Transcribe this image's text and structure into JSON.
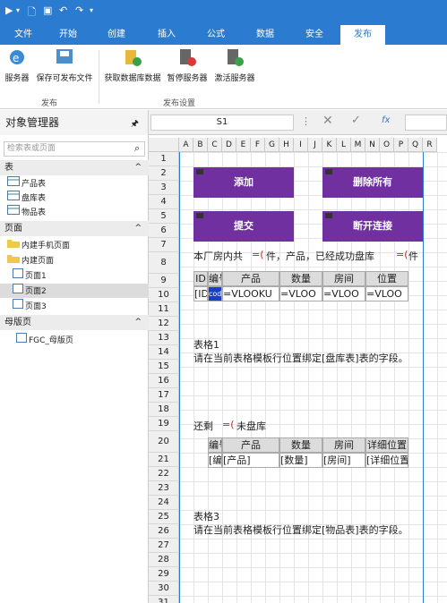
{
  "menu_tabs": [
    "文件",
    "开始",
    "创建",
    "插入",
    "公式",
    "数据",
    "安全",
    "发布"
  ],
  "ribbon": {
    "publish_group": [
      "服务器",
      "保存可发布文件"
    ],
    "publish_group_label": "发布",
    "settings_group": [
      "获取数据库数据",
      "暂停服务器",
      "激活服务器"
    ],
    "settings_group_label": "发布设置"
  },
  "object_manager": {
    "title": "对象管理器",
    "search_placeholder": "检索表或页面",
    "tables_label": "表",
    "tables": [
      "产品表",
      "盘库表",
      "物品表"
    ],
    "pages_label": "页面",
    "pages": [
      "内建手机页面",
      "内建页面",
      "页面1",
      "页面2",
      "页面3"
    ],
    "master_label": "母版页",
    "masters": [
      "FGC_母版页"
    ]
  },
  "formula_bar": {
    "cell_ref": "S1",
    "fx": "fx"
  },
  "sheet": {
    "columns": [
      "A",
      "B",
      "C",
      "D",
      "E",
      "F",
      "G",
      "H",
      "I",
      "J",
      "K",
      "L",
      "M",
      "N",
      "O",
      "P",
      "Q",
      "R"
    ],
    "rows": [
      "1",
      "2",
      "3",
      "4",
      "5",
      "6",
      "7",
      "8",
      "9",
      "10",
      "11",
      "12",
      "13",
      "14",
      "15",
      "16",
      "17",
      "18",
      "19",
      "20",
      "21",
      "22",
      "23",
      "24",
      "25",
      "26",
      "27",
      "28",
      "29",
      "30",
      "31"
    ],
    "buttons": {
      "add": "添加",
      "delete_all": "删除所有",
      "submit": "提交",
      "disconnect": "断开连接"
    },
    "row8": {
      "prefix": "本厂房内共",
      "f1": "=(",
      "mid": "件，产品，已经成功盘库",
      "f2": "=(",
      "suffix": "件"
    },
    "table1_headers": [
      "ID",
      "编号",
      "产品",
      "数量",
      "房间",
      "位置"
    ],
    "table1_row": [
      "[ID",
      "cod",
      "=VLOOKU",
      "=VLOO",
      "=VLOO",
      "=VLOO"
    ],
    "table1_caption": "表格1",
    "table1_note": "请在当前表格模板行位置绑定[盘库表]表的字段。",
    "row20": {
      "prefix": "还剩",
      "f": "=(",
      "suffix": "未盘库"
    },
    "table2_headers": [
      "编号",
      "产品",
      "数量",
      "房间",
      "详细位置"
    ],
    "table2_row": [
      "[编",
      "[产品]",
      "[数量]",
      "[房间]",
      "[详细位置"
    ],
    "table3_caption": "表格3",
    "table3_note": "请在当前表格模板行位置绑定[物品表]表的字段。"
  },
  "colors": {
    "accent": "#2b7bd0",
    "button": "#7030a0"
  }
}
